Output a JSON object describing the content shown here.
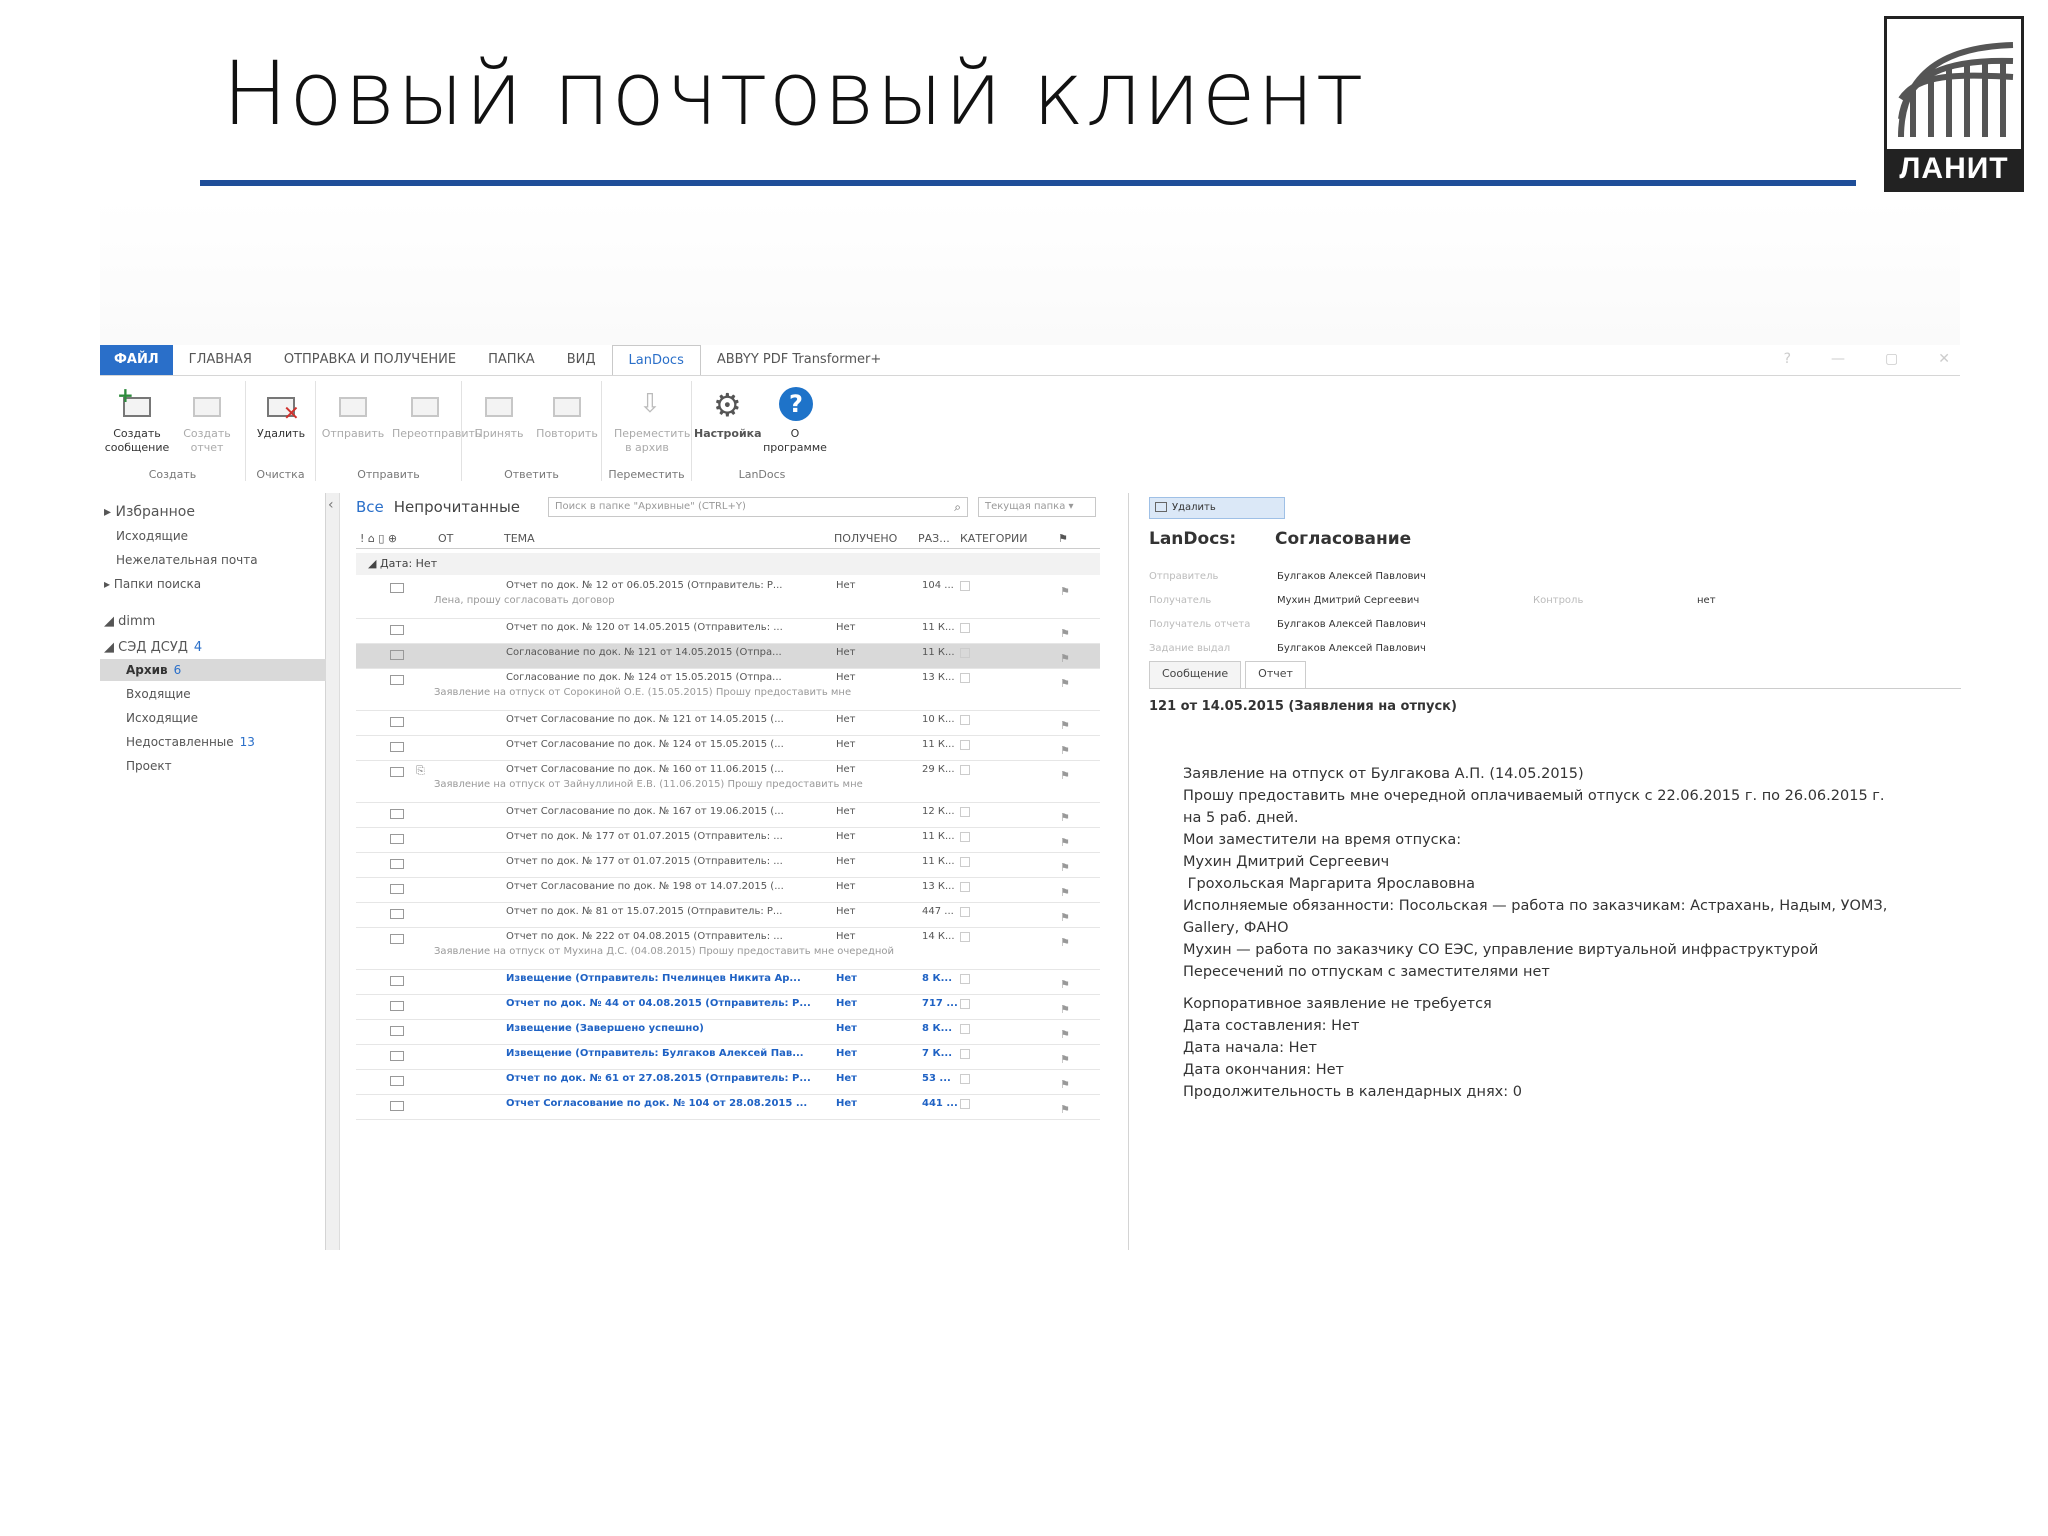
{
  "slide": {
    "title": "Новый почтовый клиент",
    "logo_text": "ЛАНИТ"
  },
  "ribbon_tabs": [
    "ФАЙЛ",
    "ГЛАВНАЯ",
    "ОТПРАВКА И ПОЛУЧЕНИЕ",
    "ПАПКА",
    "ВИД",
    "LanDocs",
    "ABBYY PDF Transformer+"
  ],
  "ribbon": {
    "create_message": "Создать сообщение",
    "create_report": "Создать отчет",
    "group_create": "Создать",
    "delete": "Удалить",
    "group_clean": "Очистка",
    "send": "Отправить",
    "forward": "Переотправить",
    "group_send": "Отправить",
    "accept": "Принять",
    "repeat": "Повторить",
    "group_reply": "Ответить",
    "move_archive": "Переместить в архив",
    "group_move": "Переместить",
    "settings": "Настройка",
    "about": "О программе",
    "group_landocs": "LanDocs"
  },
  "folders": {
    "favorites": "Избранное",
    "outbox": "Исходящие",
    "junk": "Нежелательная почта",
    "search_folders": "Папки поиска",
    "account": "dimm",
    "sed": "СЭД ДСУД",
    "sed_count": "4",
    "archive": "Архив",
    "archive_count": "6",
    "inbox": "Входящие",
    "outgoing": "Исходящие",
    "undelivered": "Недоставленные",
    "undelivered_count": "13",
    "draft": "Проект"
  },
  "list": {
    "filter_all": "Все",
    "filter_unread": "Непрочитанные",
    "search_placeholder": "Поиск в папке \"Архивные\" (CTRL+Y)",
    "scope": "Текущая папка",
    "col_from": "ОТ",
    "col_subject": "ТЕМА",
    "col_received": "ПОЛУЧЕНО",
    "col_size": "РАЗ...",
    "col_categories": "КАТЕГОРИИ",
    "group_header": "Дата: Нет",
    "rows": [
      {
        "subject": "Отчет по док. № 12 от 06.05.2015 (Отправитель: Р...",
        "received": "Нет",
        "size": "104 ...",
        "preview": "Лена, прошу согласовать договор"
      },
      {
        "subject": "Отчет по док. № 120 от 14.05.2015 (Отправитель: ...",
        "received": "Нет",
        "size": "11 К..."
      },
      {
        "subject": "Согласование по док. № 121 от 14.05.2015 (Отпра...",
        "received": "Нет",
        "size": "11 К..."
      },
      {
        "subject": "Согласование по док. № 124 от 15.05.2015 (Отпра...",
        "received": "Нет",
        "size": "13 К...",
        "preview": "Заявление на отпуск от Сорокиной О.Е. (15.05.2015) Прошу предоставить мне"
      },
      {
        "subject": "Отчет Согласование по док. № 121 от 14.05.2015 (...",
        "received": "Нет",
        "size": "10 К..."
      },
      {
        "subject": "Отчет Согласование по док. № 124 от 15.05.2015 (...",
        "received": "Нет",
        "size": "11 К..."
      },
      {
        "subject": "Отчет Согласование по док. № 160 от 11.06.2015 (...",
        "received": "Нет",
        "size": "29 К...",
        "preview": "Заявление на отпуск от Зайнуллиной Е.В. (11.06.2015) Прошу предоставить мне"
      },
      {
        "subject": "Отчет Согласование по док. № 167 от 19.06.2015 (...",
        "received": "Нет",
        "size": "12 К..."
      },
      {
        "subject": "Отчет по док. № 177 от 01.07.2015 (Отправитель: ...",
        "received": "Нет",
        "size": "11 К..."
      },
      {
        "subject": "Отчет по док. № 177 от 01.07.2015 (Отправитель: ...",
        "received": "Нет",
        "size": "11 К..."
      },
      {
        "subject": "Отчет Согласование по док. № 198 от 14.07.2015 (...",
        "received": "Нет",
        "size": "13 К..."
      },
      {
        "subject": "Отчет по док. № 81 от 15.07.2015 (Отправитель: Р...",
        "received": "Нет",
        "size": "447 ..."
      },
      {
        "subject": "Отчет по док. № 222 от 04.08.2015 (Отправитель: ...",
        "received": "Нет",
        "size": "14 К...",
        "preview": "Заявление на отпуск от Мухина Д.С. (04.08.2015) Прошу предоставить мне очередной"
      },
      {
        "subject": "Извещение (Отправитель: Пчелинцев Никита Ар...",
        "received": "Нет",
        "size": "8 К..."
      },
      {
        "subject": "Отчет по док. № 44 от 04.08.2015 (Отправитель: Р...",
        "received": "Нет",
        "size": "717 ..."
      },
      {
        "subject": "Извещение (Завершено успешно)",
        "received": "Нет",
        "size": "8 К..."
      },
      {
        "subject": "Извещение (Отправитель: Булгаков Алексей Пав...",
        "received": "Нет",
        "size": "7 К..."
      },
      {
        "subject": "Отчет по док. № 61 от 27.08.2015 (Отправитель: Р...",
        "received": "Нет",
        "size": "53 ..."
      },
      {
        "subject": "Отчет Согласование по док. № 104 от 28.08.2015 ...",
        "received": "Нет",
        "size": "441 ..."
      }
    ]
  },
  "reading": {
    "delete_button": "Удалить",
    "app": "LanDocs:",
    "type": "Согласование",
    "sender_label": "Отправитель",
    "sender": "Булгаков Алексей Павлович",
    "recipient_label": "Получатель",
    "recipient": "Мухин Дмитрий Сергеевич",
    "control_label": "Контроль",
    "control_value": "нет",
    "report_recipient_label": "Получатель отчета",
    "report_recipient": "Булгаков Алексей Павлович",
    "issuer_label": "Задание выдал",
    "issuer": "Булгаков Алексей Павлович",
    "tab_message": "Сообщение",
    "tab_report": "Отчет",
    "subject": "121 от 14.05.2015 (Заявления на отпуск)",
    "body_lines": [
      "Заявление на отпуск от Булгакова А.П. (14.05.2015)",
      "Прошу предоставить мне очередной оплачиваемый отпуск с 22.06.2015 г. по 26.06.2015 г.",
      "на 5 раб. дней.",
      "Мои заместители на время отпуска:",
      "Мухин Дмитрий Сергеевич",
      " Грохольская Маргарита Ярославовна",
      "Исполняемые обязанности: Посольская — работа по заказчикам: Астрахань, Надым, УОМЗ,",
      "Gallery, ФАНО",
      "Мухин — работа по заказчику СО ЕЭС, управление виртуальной инфраструктурой",
      "Пересечений по отпускам с заместителями нет"
    ],
    "body2_lines": [
      "Корпоративное заявление не требуется",
      "Дата составления: Нет",
      "Дата начала: Нет",
      "Дата окончания: Нет",
      "Продолжительность в календарных днях: 0"
    ]
  }
}
